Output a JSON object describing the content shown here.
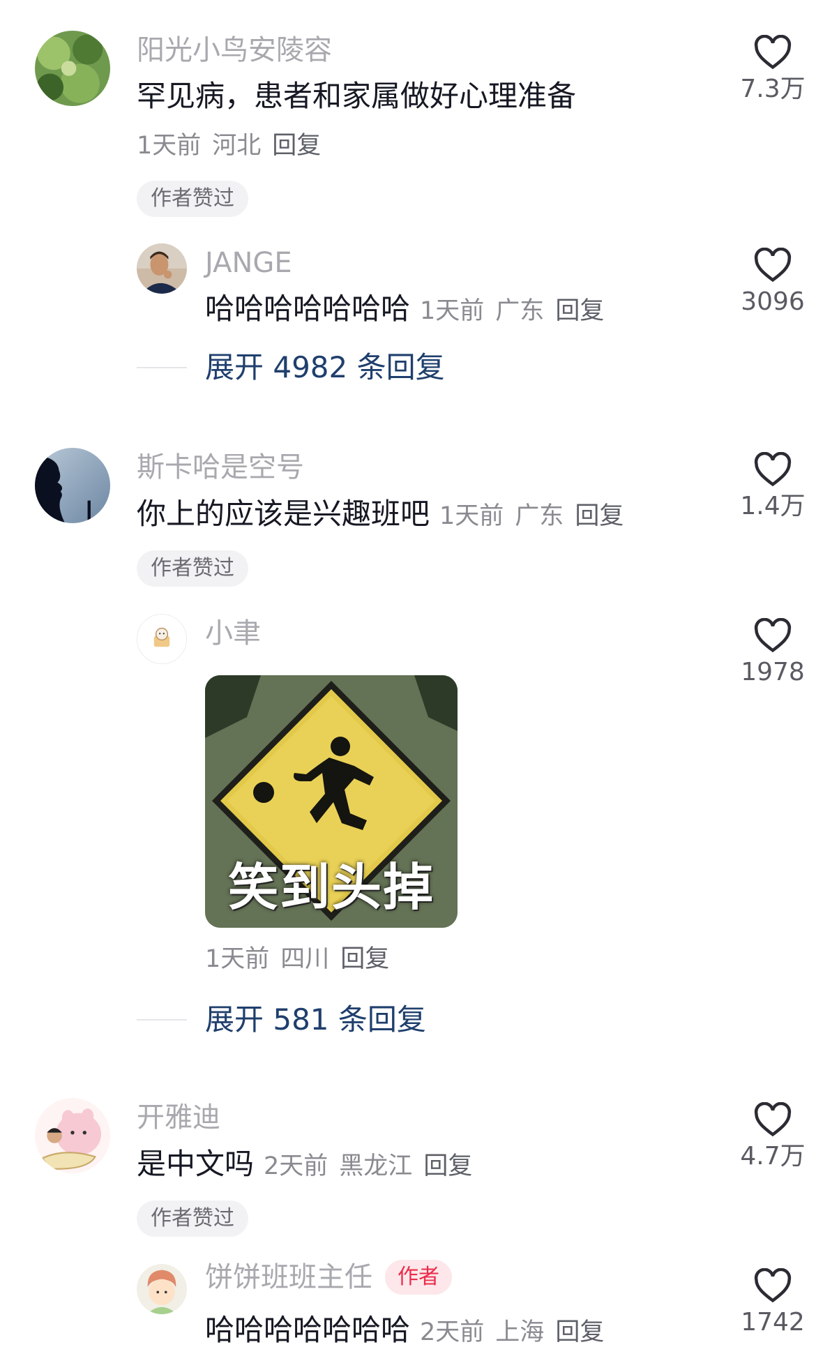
{
  "comments": [
    {
      "username": "阳光小鸟安陵容",
      "text": "罕见病，患者和家属做好心理准备",
      "time": "1天前",
      "location": "河北",
      "reply_label": "回复",
      "badge": "作者赞过",
      "likes": "7.3万",
      "reply": {
        "username": "JANGE",
        "text": "哈哈哈哈哈哈哈",
        "time": "1天前",
        "location": "广东",
        "reply_label": "回复",
        "likes": "3096"
      },
      "expand": "展开 4982 条回复"
    },
    {
      "username": "斯卡哈是空号",
      "text": "你上的应该是兴趣班吧",
      "time": "1天前",
      "location": "广东",
      "reply_label": "回复",
      "badge": "作者赞过",
      "likes": "1.4万",
      "reply": {
        "username": "小聿",
        "sticker_text": "笑到头掉",
        "time": "1天前",
        "location": "四川",
        "reply_label": "回复",
        "likes": "1978"
      },
      "expand": "展开 581 条回复"
    },
    {
      "username": "开雅迪",
      "text": "是中文吗",
      "time": "2天前",
      "location": "黑龙江",
      "reply_label": "回复",
      "badge": "作者赞过",
      "likes": "4.7万",
      "reply": {
        "username": "饼饼班班主任",
        "author_badge": "作者",
        "text": "哈哈哈哈哈哈哈",
        "time": "2天前",
        "location": "上海",
        "reply_label": "回复",
        "likes": "1742"
      }
    }
  ],
  "icons": {
    "like": "heart-outline-icon"
  },
  "colors": {
    "expand_link": "#1f3f6d",
    "author_badge_bg": "#fde7ea",
    "author_badge_text": "#ea2c4a",
    "pill_bg": "#f2f2f4"
  }
}
